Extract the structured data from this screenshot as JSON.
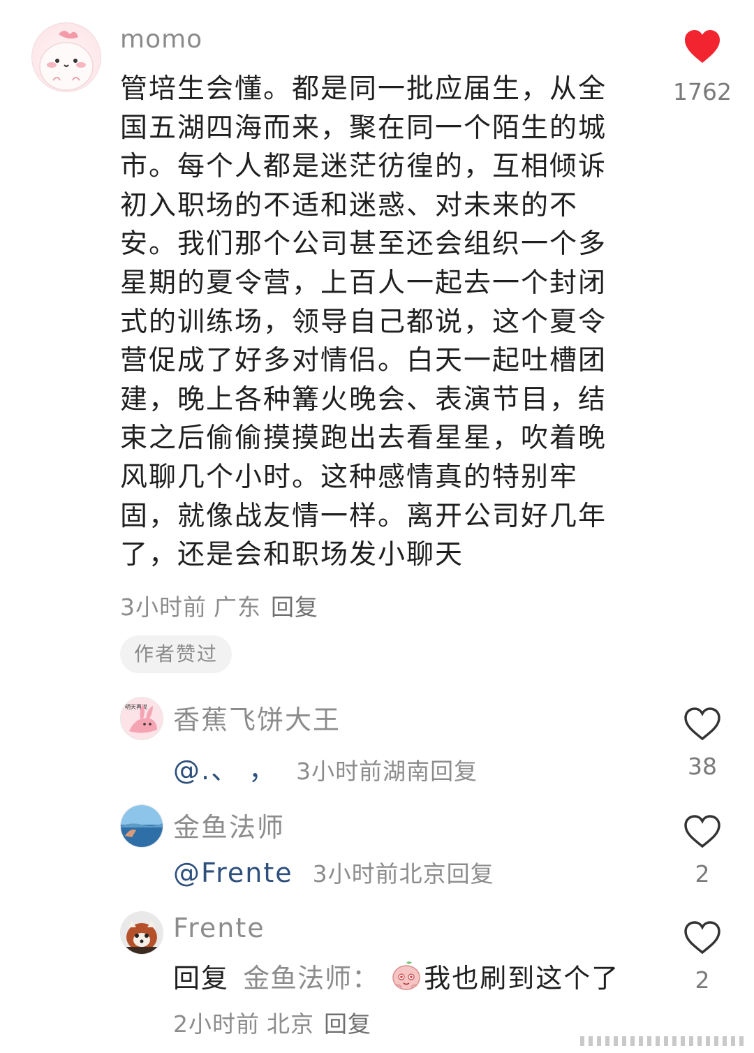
{
  "main_comment": {
    "username": "momo",
    "text": "管培生会懂。都是同一批应届生，从全\n国五湖四海而来，聚在同一个陌生的城\n市。每个人都是迷茫彷徨的，互相倾诉\n初入职场的不适和迷惑、对未来的不\n安。我们那个公司甚至还会组织一个多\n星期的夏令营，上百人一起去一个封闭\n式的训练场，领导自己都说，这个夏令\n营促成了好多对情侣。白天一起吐槽团\n建，晚上各种篝火晚会、表演节目，结\n束之后偷偷摸摸跑出去看星星，吹着晚\n风聊几个小时。这种感情真的特别牢\n固，就像战友情一样。离开公司好几年\n了，还是会和职场发小聊天",
    "time": "3小时前",
    "location": "广东",
    "reply_label": "回复",
    "author_liked_badge": "作者赞过",
    "like_count": "1762",
    "like_color": "#f2242f"
  },
  "replies": [
    {
      "username": "香蕉飞饼大王",
      "avatar_text": "明天再说",
      "mention": "@.、 ，",
      "time": "3小时前",
      "location": "湖南",
      "reply_label": "回复",
      "like_count": "38"
    },
    {
      "username": "金鱼法师",
      "mention": "@Frente",
      "time": "3小时前",
      "location": "北京",
      "reply_label": "回复",
      "like_count": "2"
    },
    {
      "username": "Frente",
      "reply_prefix": "回复",
      "reply_to": "金鱼法师：",
      "text": "我也刷到这个了",
      "time": "2小时前",
      "location": "北京",
      "reply_label": "回复",
      "like_count": "2"
    }
  ],
  "icons": {
    "like": "heart-icon",
    "like_filled": "heart-filled-icon",
    "emoji": "blushing-peach-emoji"
  }
}
